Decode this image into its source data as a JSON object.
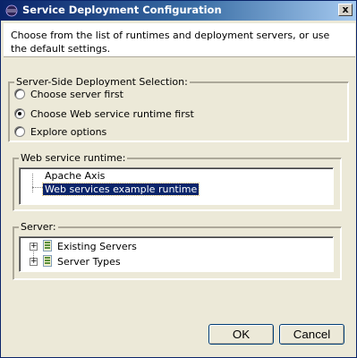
{
  "window": {
    "title": "Service Deployment Configuration",
    "close_glyph": "x"
  },
  "description": "Choose from the list of runtimes and deployment servers, or use the default settings.",
  "deployment_selection": {
    "legend": "Server-Side Deployment Selection:",
    "options": [
      {
        "label": "Choose server first",
        "checked": false
      },
      {
        "label": "Choose Web service runtime first",
        "checked": true
      },
      {
        "label": "Explore options",
        "checked": false
      }
    ]
  },
  "runtime_group": {
    "legend": "Web service runtime:",
    "items": [
      {
        "label": "Apache Axis",
        "selected": false
      },
      {
        "label": "Web services example runtime",
        "selected": true
      }
    ]
  },
  "server_group": {
    "legend": "Server:",
    "items": [
      {
        "label": "Existing Servers",
        "expander": "+",
        "icon": "server-folder-icon"
      },
      {
        "label": "Server Types",
        "expander": "+",
        "icon": "server-folder-icon"
      }
    ]
  },
  "buttons": {
    "ok": "OK",
    "cancel": "Cancel"
  }
}
